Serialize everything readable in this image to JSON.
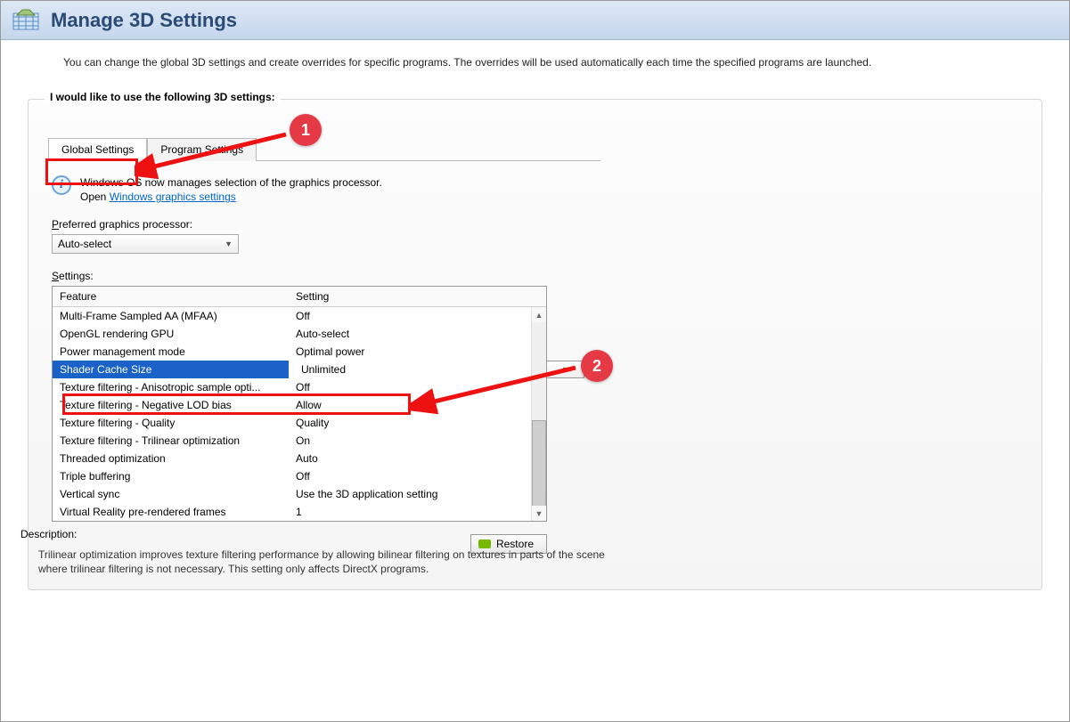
{
  "title": "Manage 3D Settings",
  "intro": "You can change the global 3D settings and create overrides for specific programs. The overrides will be used automatically each time the specified programs are launched.",
  "groupbox_legend": "I would like to use the following 3D settings:",
  "tabs": {
    "global": "Global Settings",
    "program": "Program Settings"
  },
  "info": {
    "line1": "Windows OS now manages selection of the graphics processor.",
    "line2_prefix": "Open ",
    "link": "Windows graphics settings"
  },
  "preferred_label": "Preferred graphics processor:",
  "preferred_value": "Auto-select",
  "settings_label": "Settings:",
  "columns": {
    "feature": "Feature",
    "setting": "Setting"
  },
  "rows": [
    {
      "feature": "Multi-Frame Sampled AA (MFAA)",
      "setting": "Off"
    },
    {
      "feature": "OpenGL rendering GPU",
      "setting": "Auto-select"
    },
    {
      "feature": "Power management mode",
      "setting": "Optimal power"
    },
    {
      "feature": "Shader Cache Size",
      "setting": "Unlimited",
      "selected": true
    },
    {
      "feature": "Texture filtering - Anisotropic sample opti...",
      "setting": "Off"
    },
    {
      "feature": "Texture filtering - Negative LOD bias",
      "setting": "Allow"
    },
    {
      "feature": "Texture filtering - Quality",
      "setting": "Quality"
    },
    {
      "feature": "Texture filtering - Trilinear optimization",
      "setting": "On"
    },
    {
      "feature": "Threaded optimization",
      "setting": "Auto"
    },
    {
      "feature": "Triple buffering",
      "setting": "Off"
    },
    {
      "feature": "Vertical sync",
      "setting": "Use the 3D application setting"
    },
    {
      "feature": "Virtual Reality pre-rendered frames",
      "setting": "1"
    }
  ],
  "restore_label": "Restore",
  "description_label": "Description:",
  "description_text": "Trilinear optimization improves texture filtering performance by allowing bilinear filtering on textures in parts of the scene where trilinear filtering is not necessary. This setting only affects DirectX programs.",
  "annotations": {
    "badge1": "1",
    "badge2": "2"
  }
}
